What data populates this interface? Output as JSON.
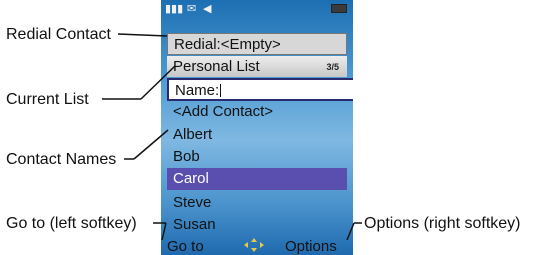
{
  "callouts": {
    "redial_contact": "Redial Contact",
    "current_list": "Current List",
    "contact_names": "Contact Names",
    "go_to_left_softkey": "Go to (left softkey)",
    "options_right_softkey": "Options (right softkey)"
  },
  "phone": {
    "redial": "Redial:<Empty>",
    "list_name": "Personal List",
    "list_count": "3/5",
    "name_field_label": "Name:",
    "add_contact": "<Add Contact>",
    "contacts": [
      "Albert",
      "Bob",
      "Carol",
      "Steve",
      "Susan"
    ],
    "selected_contact": "Carol",
    "left_softkey": "Go to",
    "right_softkey": "Options"
  },
  "colors": {
    "screen_blue": "#4d9ad2",
    "selection": "#5a4fae",
    "field_border": "#2c2a6e"
  },
  "icons": [
    "signal-icon",
    "network-icon",
    "speaker-icon",
    "battery-icon",
    "nav-arrows-icon"
  ]
}
